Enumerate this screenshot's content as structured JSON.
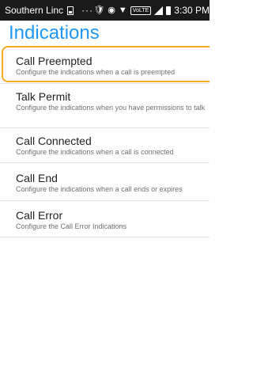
{
  "status_bar": {
    "carrier": "Southern Linc",
    "dots": "···",
    "volte_label": "VoLTE",
    "time": "3:30 PM"
  },
  "page": {
    "title": "Indications"
  },
  "items": [
    {
      "title": "Call Preempted",
      "summary": "Configure the indications when a call is preempted"
    },
    {
      "title": "Talk Permit",
      "summary": "Configure the indications when you have permissions to talk"
    },
    {
      "title": "Call Connected",
      "summary": "Configure the indications when a call is connected"
    },
    {
      "title": "Call End",
      "summary": "Configure the indications when a call ends or expires"
    },
    {
      "title": "Call Error",
      "summary": "Configure the Call Error Indications"
    }
  ],
  "colors": {
    "accent": "#2196f3",
    "highlight": "#f5a91f",
    "status_bar": "#1a1a1a"
  }
}
